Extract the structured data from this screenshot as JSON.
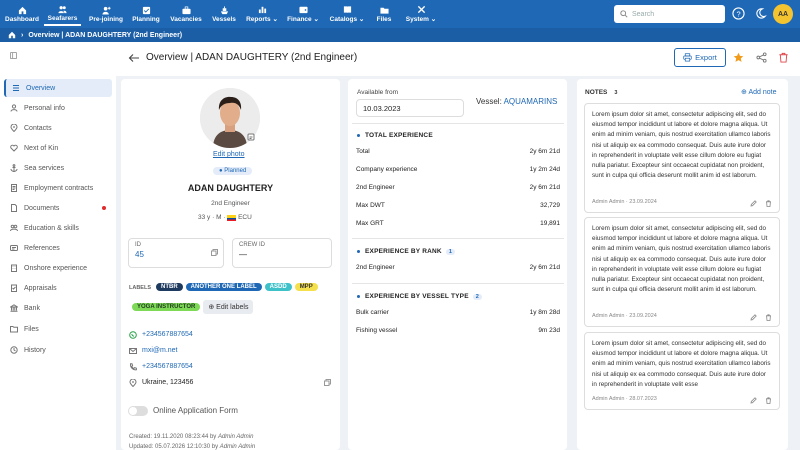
{
  "nav": [
    {
      "label": "Dashboard",
      "icon": "home-icon"
    },
    {
      "label": "Seafarers",
      "icon": "people-icon"
    },
    {
      "label": "Pre-joining",
      "icon": "person-plus-icon"
    },
    {
      "label": "Planning",
      "icon": "checklist-icon"
    },
    {
      "label": "Vacancies",
      "icon": "briefcase-icon"
    },
    {
      "label": "Vessels",
      "icon": "ship-icon"
    },
    {
      "label": "Reports",
      "icon": "chart-icon"
    },
    {
      "label": "Finance",
      "icon": "wallet-icon"
    },
    {
      "label": "Catalogs",
      "icon": "book-icon"
    },
    {
      "label": "Files",
      "icon": "folder-icon"
    },
    {
      "label": "System",
      "icon": "tools-icon"
    }
  ],
  "search": {
    "placeholder": "Search"
  },
  "user": {
    "initials": "AA"
  },
  "breadcrumb": {
    "title": "Overview | ADAN DAUGHTERY (2nd Engineer)"
  },
  "sidebar": {
    "items": [
      {
        "label": "Overview",
        "icon": "list-icon"
      },
      {
        "label": "Personal info",
        "icon": "user-icon"
      },
      {
        "label": "Contacts",
        "icon": "location-icon"
      },
      {
        "label": "Next of Kin",
        "icon": "heart-icon"
      },
      {
        "label": "Sea services",
        "icon": "anchor-icon"
      },
      {
        "label": "Employment contracts",
        "icon": "contract-icon"
      },
      {
        "label": "Documents",
        "icon": "document-icon"
      },
      {
        "label": "Education & skills",
        "icon": "education-icon"
      },
      {
        "label": "References",
        "icon": "references-icon"
      },
      {
        "label": "Onshore experience",
        "icon": "building-icon"
      },
      {
        "label": "Appraisals",
        "icon": "appraisal-icon"
      },
      {
        "label": "Bank",
        "icon": "bank-icon"
      },
      {
        "label": "Files",
        "icon": "files-icon"
      },
      {
        "label": "History",
        "icon": "history-icon"
      }
    ]
  },
  "header": {
    "title": "Overview | ADAN DAUGHTERY (2nd Engineer)",
    "export_label": "Export"
  },
  "profile": {
    "edit_photo": "Edit photo",
    "status": "Planned",
    "name": "ADAN DAUGHTERY",
    "rank": "2nd Engineer",
    "age": "33 y",
    "sex": "M",
    "nationality": "ECU",
    "id_label": "ID",
    "id_value": "45",
    "crew_id_label": "CREW ID",
    "crew_id_value": "—",
    "labels_title": "LABELS",
    "labels": [
      {
        "text": "NTBR",
        "bg": "#1e3a5f",
        "fg": "#ffffff"
      },
      {
        "text": "ANOTHER ONE LABEL",
        "bg": "#1f68b5",
        "fg": "#ffffff"
      },
      {
        "text": "ASDD",
        "bg": "#3fc1c9",
        "fg": "#ffffff"
      },
      {
        "text": "MPP",
        "bg": "#f4e04d",
        "fg": "#333333"
      },
      {
        "text": "YOGA INSTRUCTOR",
        "bg": "#7ed957",
        "fg": "#1e3a1e"
      }
    ],
    "edit_labels": "Edit labels",
    "whatsapp": "+234567887654",
    "email": "mxi@m.net",
    "phone": "+234567887654",
    "address": "Ukraine, 123456",
    "online_form": "Online Application Form",
    "created_label": "Created: 19.11.2020 08:23:44 by",
    "created_by": "Admin Admin",
    "updated_label": "Updated: 05.07.2026 12:10:30 by",
    "updated_by": "Admin Admin"
  },
  "experience": {
    "available_label": "Available from",
    "available_value": "10.03.2023",
    "vessel_label": "Vessel:",
    "vessel_value": "AQUAMARINS",
    "total_title": "TOTAL EXPERIENCE",
    "total_rows": [
      {
        "label": "Total",
        "value": "2y 6m 21d"
      },
      {
        "label": "Company experience",
        "value": "1y 2m 24d"
      },
      {
        "label": "2nd Engineer",
        "value": "2y 6m 21d"
      },
      {
        "label": "Max DWT",
        "value": "32,729"
      },
      {
        "label": "Max GRT",
        "value": "19,891"
      }
    ],
    "rank_title": "EXPERIENCE BY RANK",
    "rank_count": "1",
    "rank_rows": [
      {
        "label": "2nd Engineer",
        "value": "2y 6m 21d"
      }
    ],
    "vtype_title": "EXPERIENCE BY VESSEL TYPE",
    "vtype_count": "2",
    "vtype_rows": [
      {
        "label": "Bulk carrier",
        "value": "1y 8m 28d"
      },
      {
        "label": "Fishing vessel",
        "value": "9m 23d"
      }
    ]
  },
  "notes": {
    "title": "NOTES",
    "count": "3",
    "add_label": "Add note",
    "items": [
      {
        "text": "Lorem ipsum dolor sit amet, consectetur adipiscing elit, sed do eiusmod tempor incididunt ut labore et dolore magna aliqua. Ut enim ad minim veniam, quis nostrud exercitation ullamco laboris nisi ut aliquip ex ea commodo consequat. Duis aute irure dolor in reprehenderit in voluptate velit esse cillum dolore eu fugiat nulla pariatur. Excepteur sint occaecat cupidatat non proident, sunt in culpa qui officia deserunt mollit anim id est laborum.",
        "meta": "Admin Admin · 23.09.2024"
      },
      {
        "text": "Lorem ipsum dolor sit amet, consectetur adipiscing elit, sed do eiusmod tempor incididunt ut labore et dolore magna aliqua. Ut enim ad minim veniam, quis nostrud exercitation ullamco laboris nisi ut aliquip ex ea commodo consequat. Duis aute irure dolor in reprehenderit in voluptate velit esse cillum dolore eu fugiat nulla pariatur. Excepteur sint occaecat cupidatat non proident, sunt in culpa qui officia deserunt mollit anim id est laborum.",
        "meta": "Admin Admin · 23.09.2024"
      },
      {
        "text": "Lorem ipsum dolor sit amet, consectetur adipiscing elit, sed do eiusmod tempor incididunt ut labore et dolore magna aliqua. Ut enim ad minim veniam, quis nostrud exercitation ullamco laboris nisi ut aliquip ex ea commodo consequat. Duis aute irure dolor in reprehenderit in voluptate velit esse",
        "meta": "Admin Admin · 28.07.2023"
      }
    ]
  }
}
